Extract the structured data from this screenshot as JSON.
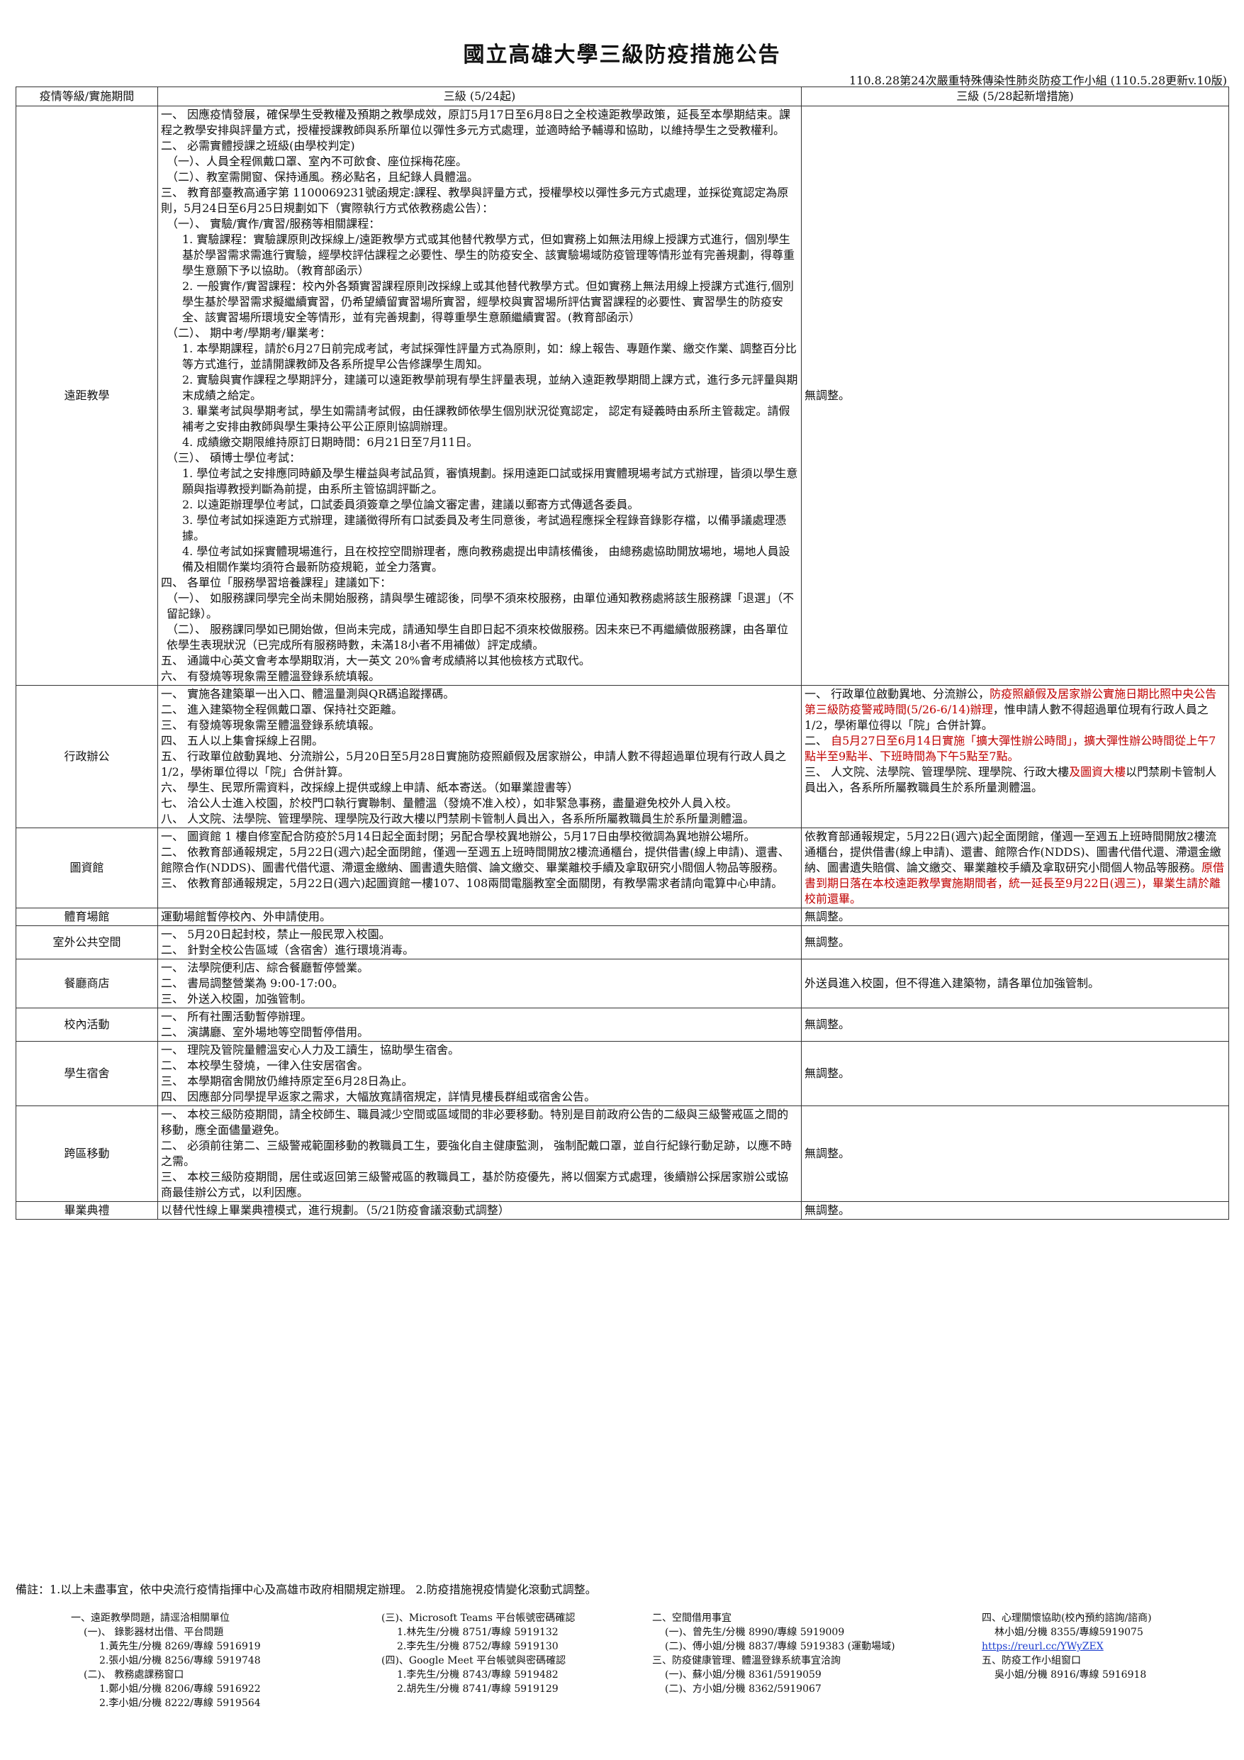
{
  "title": "國立高雄大學三級防疫措施公告",
  "subnote": "110.8.28第24次嚴重特殊傳染性肺炎防疫工作小組 (110.5.28更新v.10版)",
  "headers": {
    "cat": "疫情等級/實施期間",
    "level3": "三級 (5/24起)",
    "new": "三級 (5/28起新增措施)"
  },
  "rows": [
    {
      "cat": "遠距教學",
      "left": [
        "一、 因應疫情發展，確保學生受教權及預期之教學成效，原訂5月17日至6月8日之全校遠距教學政策，延長至本學期結束。課程之教學安排與評量方式，授權授課教師與系所單位以彈性多元方式處理，並適時給予輔導和協助，以維持學生之受教權利。",
        "二、 必需實體授課之班級(由學校判定)",
        "（一）、人員全程佩戴口罩、室內不可飲食、座位採梅花座。",
        "（二）、教室需開窗、保持通風。務必點名，且紀錄人員體溫。",
        "三、 教育部臺教高通字第 1100069231號函規定:課程、教學與評量方式，授權學校以彈性多元方式處理，並採從寬認定為原則，5月24日至6月25日規劃如下（實際執行方式依教務處公告）：",
        "（一）、 實驗/實作/實習/服務等相關課程：",
        "1. 實驗課程：實驗課原則改採線上/遠距教學方式或其他替代教學方式，但如實務上如無法用線上授課方式進行，個別學生基於學習需求需進行實驗，經學校評估課程之必要性、學生的防疫安全、該實驗場域防疫管理等情形並有完善規劃，得尊重學生意願下予以協助。（教育部函示）",
        "2. 一般實作/實習課程：校內外各類實習課程原則改採線上或其他替代教學方式。但如實務上無法用線上授課方式進行,個別學生基於學習需求擬繼續實習，仍希望續留實習場所實習，經學校與實習場所評估實習課程的必要性、實習學生的防疫安全、該實習場所環境安全等情形，並有完善規劃，得尊重學生意願繼續實習。(教育部函示）",
        "（二）、 期中考/學期考/畢業考：",
        "1. 本學期課程，請於6月27日前完成考試，考試採彈性評量方式為原則，如：線上報告、專題作業、繳交作業、調整百分比等方式進行，並請開課教師及各系所提早公告修課學生周知。",
        "2. 實驗與實作課程之學期評分，建議可以遠距教學前現有學生評量表現，並納入遠距教學期間上課方式，進行多元評量與期末成績之給定。",
        "3. 畢業考試與學期考試，學生如需請考試假，由任課教師依學生個別狀況從寬認定， 認定有疑義時由系所主管裁定。請假補考之安排由教師與學生秉持公平公正原則協調辦理。",
        "4. 成績繳交期限維持原訂日期時間：6月21日至7月11日。",
        "（三）、 碩博士學位考試：",
        "1. 學位考試之安排應同時顧及學生權益與考試品質，審慎規劃。採用遠距口試或採用實體現場考試方式辦理，皆須以學生意願與指導教授判斷為前提，由系所主管協調評斷之。",
        "2. 以遠距辦理學位考試，口試委員須簽章之學位論文審定書，建議以郵寄方式傳遞各委員。",
        "3. 學位考試如採遠距方式辦理，建議徵得所有口試委員及考生同意後，考試過程應採全程錄音錄影存檔，以備爭議處理憑據。",
        "4. 學位考試如採實體現場進行，且在校控空間辦理者，應向教務處提出申請核備後， 由總務處協助開放場地，場地人員設備及相關作業均須符合最新防疫規範，並全力落實。",
        "四、 各單位「服務學習培養課程」建議如下：",
        "（一）、 如服務課同學完全尚未開始服務，請與學生確認後，同學不須來校服務，由單位通知教務處將該生服務課「退選」（不留記錄）。",
        "（二）、 服務課同學如已開始做，但尚未完成，請通知學生自即日起不須來校做服務。因未來已不再繼續做服務課，由各單位依學生表現狀況（已完成所有服務時數，未滿18小者不用補做）評定成績。",
        "五、 通識中心英文會考本學期取消，大一英文 20%會考成績將以其他檢核方式取代。",
        "六、 有發燒等現象需至體溫登錄系統填報。"
      ],
      "right": [
        "無調整。"
      ]
    },
    {
      "cat": "行政辦公",
      "left": [
        "一、 實施各建築單一出入口、體溫量測與QR碼追蹤擇碼。",
        "二、 進入建築物全程佩戴口罩、保持社交距離。",
        "三、 有發燒等現象需至體溫登錄系統填報。",
        "四、 五人以上集會採線上召開。",
        "五、 行政單位啟動異地、分流辦公，5月20日至5月28日實施防疫照顧假及居家辦公，申請人數不得超過單位現有行政人員之1/2，學術單位得以「院」合併計算。",
        "六、 學生、民眾所需資料，改採線上提供或線上申請、紙本寄送。（如畢業證書等）",
        "七、 洽公人士進入校園，於校門口執行實聯制、量體溫（發燒不准入校），如非緊急事務，盡量避免校外人員入校。",
        "八、 人文院、法學院、管理學院、理學院及行政大樓以門禁刷卡管制人員出入，各系所所屬教職員生於系所量測體溫。"
      ],
      "right": [
        "一、 行政單位啟動異地、分流辦公，",
        "防疫照顧假及居家辦公實施日期比照中央公告第三級防疫警戒時間(5/26-6/14)辦理",
        "，惟申請人數不得超過單位現有行政人員之1/2，學術單位得以「院」合併計算。",
        "二、 ",
        "自5月27日至6月14日實施「擴大彈性辦公時間」，擴大彈性辦公時間從上午7點半至9點半、下班時間為下午5點至7點。",
        "三、 人文院、法學院、管理學院、理學院、行政大樓",
        "及圖資大樓",
        "以門禁刷卡管制人員出入，各系所所屬教職員生於系所量測體溫。"
      ]
    },
    {
      "cat": "圖資館",
      "left": [
        "一、 圖資館 1 樓自修室配合防疫於5月14日起全面封閉；另配合學校異地辦公，5月17日由學校徵調為異地辦公場所。",
        "二、 依教育部通報規定，5月22日(週六)起全面閉館，僅週一至週五上班時間開放2樓流通櫃台，提供借書(線上申請)、還書、館際合作(NDDS)、圖書代借代還、滯還金繳納、圖書遺失賠償、論文繳交、畢業離校手續及拿取研究小間個人物品等服務。",
        "三、 依教育部通報規定，5月22日(週六)起圖資館一樓107、108兩間電腦教室全面關閉，有教學需求者請向電算中心申請。"
      ],
      "right": [
        "依教育部通報規定，5月22日(週六)起全面閉館，僅週一至週五上班時間開放2樓流通櫃台，提供借書(線上申請)、還書、館際合作(NDDS)、圖書代借代還、滯還金繳納、圖書遺失賠償、論文繳交、畢業離校手續及拿取研究小間個人物品等服務。",
        "原借書到期日落在本校遠距教學實施期間者，統一延長至9月22日(週三)，畢業生請於離校前還畢。"
      ]
    },
    {
      "cat": "體育場館",
      "left": [
        "運動場館暫停校內、外申請使用。"
      ],
      "right": [
        "無調整。"
      ]
    },
    {
      "cat": "室外公共空間",
      "left": [
        "一、 5月20日起封校，禁止一般民眾入校園。",
        "二、 針對全校公告區域（含宿舍）進行環境消毒。"
      ],
      "right": [
        "無調整。"
      ]
    },
    {
      "cat": "餐廳商店",
      "left": [
        "一、 法學院便利店、綜合餐廳暫停營業。",
        "二、 書局調整營業為 9:00-17:00。",
        "三、 外送入校園，加強管制。"
      ],
      "right": [
        "外送員進入校園，但不得進入建築物，請各單位加強管制。"
      ]
    },
    {
      "cat": "校內活動",
      "left": [
        "一、 所有社團活動暫停辦理。",
        "二、 演講廳、室外場地等空間暫停借用。"
      ],
      "right": [
        "無調整。"
      ]
    },
    {
      "cat": "學生宿舍",
      "left": [
        "一、 理院及管院量體溫安心人力及工讀生，協助學生宿舍。",
        "二、 本校學生發燒，一律入住安居宿舍。",
        "三、 本學期宿舍開放仍維持原定至6月28日為止。",
        "四、 因應部分同學提早返家之需求，大幅放寬請宿規定，詳情見樓長群組或宿舍公告。"
      ],
      "right": [
        "無調整。"
      ]
    },
    {
      "cat": "跨區移動",
      "left": [
        "一、 本校三級防疫期間，請全校師生、職員減少空間或區域間的非必要移動。特別是目前政府公告的二級與三級警戒區之間的移動，應全面儘量避免。",
        "二、 必須前往第二、三級警戒範圍移動的教職員工生，要強化自主健康監測， 強制配戴口罩，並自行紀錄行動足跡，以應不時之需。",
        "三、 本校三級防疫期間，居住或返回第三級警戒區的教職員工，基於防疫優先，將以個案方式處理，後續辦公採居家辦公或協商最佳辦公方式，以利因應。"
      ],
      "right": [
        "無調整。"
      ]
    },
    {
      "cat": "畢業典禮",
      "left": [
        "以替代性線上畢業典禮模式，進行規劃。（5/21防疫會議滾動式調整）"
      ],
      "right": [
        "無調整。"
      ]
    }
  ],
  "footnote": "備註：1.以上未盡事宜，依中央流行疫情指揮中心及高雄市政府相關規定辦理。 2.防疫措施視疫情變化滾動式調整。",
  "contacts": {
    "c1": [
      "一、遠距教學問題，請逕洽相關單位",
      "(一)、 錄影器材出借、平台問題",
      "1.黃先生/分機 8269/專線 5916919",
      "2.張小姐/分機 8256/專線 5919748",
      "(二)、 教務處課務窗口",
      "1.鄭小姐/分機 8206/專線 5916922",
      "2.李小姐/分機 8222/專線 5919564"
    ],
    "c2": [
      "(三)、Microsoft Teams 平台帳號密碼確認",
      "1.林先生/分機 8751/專線 5919132",
      "2.李先生/分機 8752/專線 5919130",
      "(四)、Google Meet 平台帳號與密碼確認",
      "1.李先生/分機 8743/專線 5919482",
      "2.胡先生/分機 8741/專線 5919129"
    ],
    "c3": [
      "二、空間借用事宜",
      "(一)、曾先生/分機 8990/專線 5919009",
      "(二)、傅小姐/分機 8837/專線 5919383 (運動場域)",
      "三、防疫健康管理、體溫登錄系統事宜洽詢",
      "(一)、蘇小姐/分機 8361/5919059",
      "(二)、方小姐/分機 8362/5919067"
    ],
    "c4": [
      "四、心理關懷協助(校內預約諮詢/諮商)",
      "林小姐/分機 8355/專線5919075",
      "https://reurl.cc/YWyZEX",
      "五、防疫工作小組窗口",
      "吳小姐/分機 8916/專線 5916918"
    ]
  }
}
